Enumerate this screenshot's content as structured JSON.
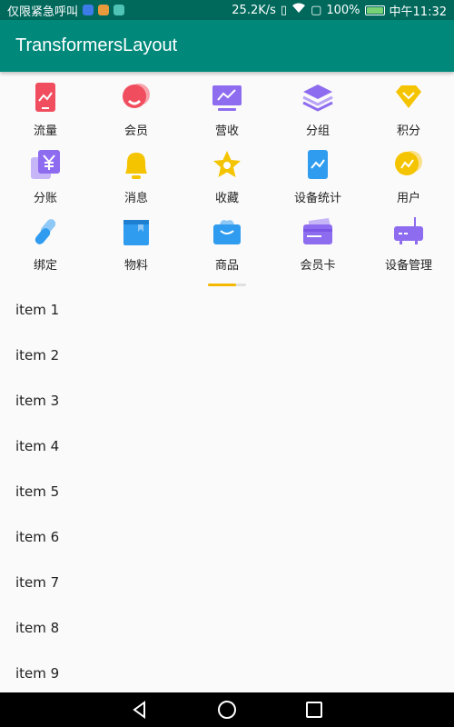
{
  "status_bar": {
    "carrier_text": "仅限紧急呼叫",
    "net_speed": "25.2K/s",
    "battery_percent": "100%",
    "time": "中午11:32",
    "battery_color": "#76d275"
  },
  "app_bar": {
    "title": "TransformersLayout",
    "color": "#00897b"
  },
  "grid_items": [
    {
      "label": "流量",
      "icon": "tablet-chart-icon",
      "color": "#f04e5e"
    },
    {
      "label": "会员",
      "icon": "member-icon",
      "color": "#f04e5e"
    },
    {
      "label": "营收",
      "icon": "monitor-chart-icon",
      "color": "#8e6cf0"
    },
    {
      "label": "分组",
      "icon": "layers-icon",
      "color": "#8e6cf0"
    },
    {
      "label": "积分",
      "icon": "diamond-icon",
      "color": "#f5c400"
    },
    {
      "label": "分账",
      "icon": "yen-icon",
      "color": "#8e6cf0"
    },
    {
      "label": "消息",
      "icon": "bell-icon",
      "color": "#f5c400"
    },
    {
      "label": "收藏",
      "icon": "star-icon",
      "color": "#f5c400"
    },
    {
      "label": "设备统计",
      "icon": "phone-chart-icon",
      "color": "#2f9cf0"
    },
    {
      "label": "用户",
      "icon": "user-icon",
      "color": "#f5c400"
    },
    {
      "label": "绑定",
      "icon": "link-icon",
      "color": "#2f9cf0"
    },
    {
      "label": "物料",
      "icon": "box-icon",
      "color": "#2f9cf0"
    },
    {
      "label": "商品",
      "icon": "basket-icon",
      "color": "#2f9cf0"
    },
    {
      "label": "会员卡",
      "icon": "card-icon",
      "color": "#8e6cf0"
    },
    {
      "label": "设备管理",
      "icon": "router-icon",
      "color": "#8e6cf0"
    }
  ],
  "page_indicator": {
    "active_color": "#f5b800",
    "track_color": "#e0e0e0",
    "progress": 0.75
  },
  "list_items": [
    "item 1",
    "item 2",
    "item 3",
    "item 4",
    "item 5",
    "item 6",
    "item 7",
    "item 8",
    "item 9"
  ]
}
